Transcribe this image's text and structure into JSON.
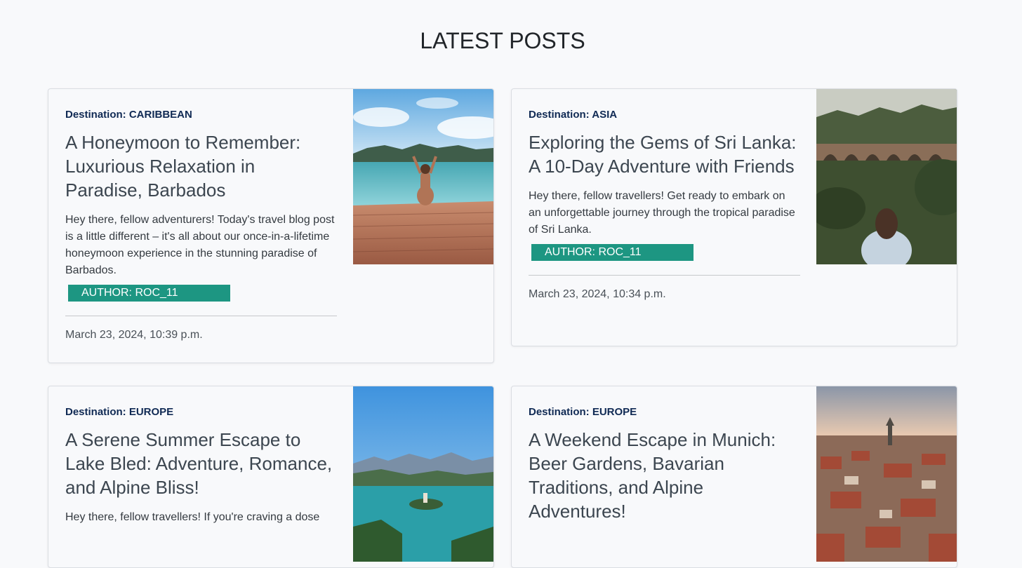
{
  "page": {
    "title": "LATEST POSTS"
  },
  "posts": [
    {
      "destination": "Destination: CARIBBEAN",
      "title": "A Honeymoon to Remember: Luxurious Relaxation in Paradise, Barbados",
      "excerpt": "Hey there, fellow adventurers! Today's travel blog post is a little different – it's all about our once-in-a-lifetime honeymoon experience in the stunning paradise of Barbados.",
      "author": "AUTHOR: ROC_11",
      "date": "March 23, 2024, 10:39 p.m.",
      "image": "woman-on-pier-photo"
    },
    {
      "destination": "Destination: ASIA",
      "title": "Exploring the Gems of Sri Lanka: A 10-Day Adventure with Friends",
      "excerpt": "Hey there, fellow travellers! Get ready to embark on an unforgettable journey through the tropical paradise of Sri Lanka.",
      "author": "AUTHOR: ROC_11",
      "date": "March 23, 2024, 10:34 p.m.",
      "image": "nine-arch-bridge-photo"
    },
    {
      "destination": "Destination: EUROPE",
      "title": "A Serene Summer Escape to Lake Bled: Adventure, Romance, and Alpine Bliss!",
      "excerpt": "Hey there, fellow travellers! If you're craving a dose",
      "image": "lake-bled-photo"
    },
    {
      "destination": "Destination: EUROPE",
      "title": "A Weekend Escape in Munich: Beer Gardens, Bavarian Traditions, and Alpine Adventures!",
      "image": "munich-rooftops-photo"
    }
  ],
  "colors": {
    "destination": "#102a54",
    "author_badge": "#1d9682",
    "background": "#f8f9fb"
  }
}
